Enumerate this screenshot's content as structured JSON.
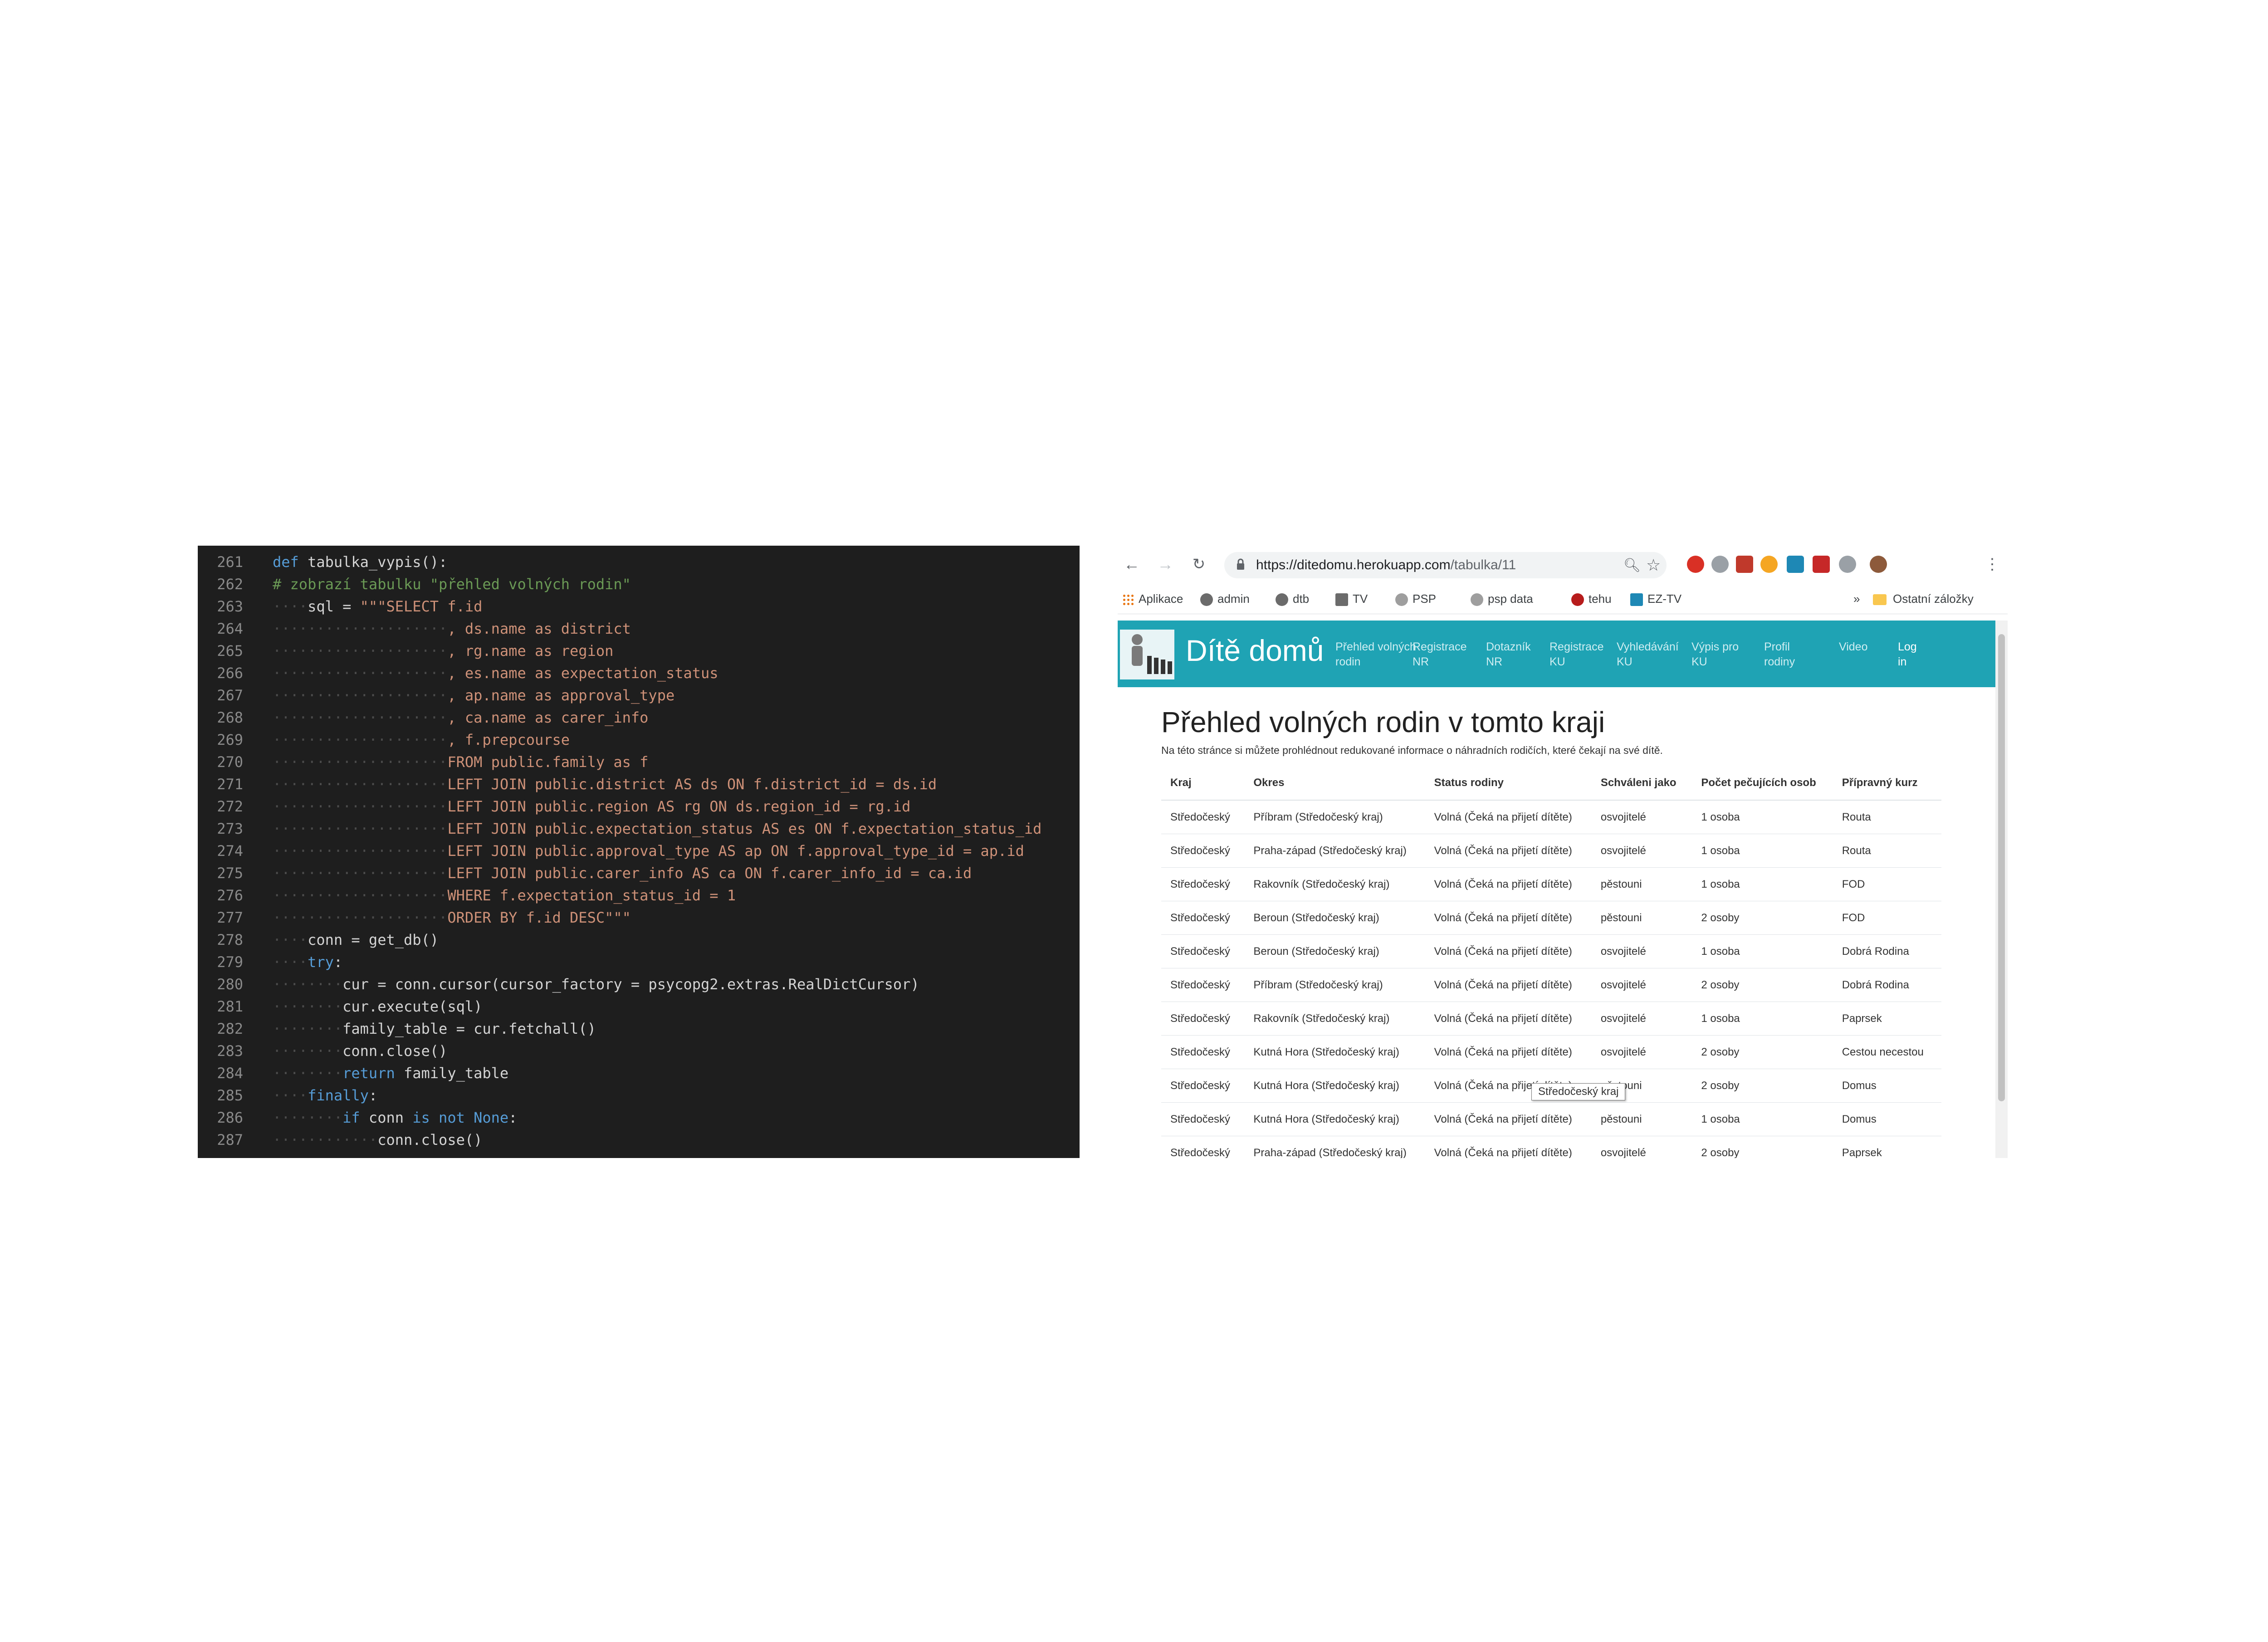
{
  "editor": {
    "lines": [
      {
        "n": "261",
        "parts": [
          {
            "t": "def",
            "c": "kw"
          },
          {
            "t": " tabulka_vypis():",
            "c": ""
          }
        ]
      },
      {
        "n": "262",
        "parts": [
          {
            "t": "# zobrazí tabulku \"přehled volných rodin\"",
            "c": "cm"
          }
        ]
      },
      {
        "n": "263",
        "parts": [
          {
            "t": "····",
            "c": "ws"
          },
          {
            "t": "sql = ",
            "c": ""
          },
          {
            "t": "\"\"\"SELECT f.id",
            "c": "str"
          }
        ]
      },
      {
        "n": "264",
        "parts": [
          {
            "t": "····················",
            "c": "ws"
          },
          {
            "t": ", ds.name as district",
            "c": "str"
          }
        ]
      },
      {
        "n": "265",
        "parts": [
          {
            "t": "····················",
            "c": "ws"
          },
          {
            "t": ", rg.name as region",
            "c": "str"
          }
        ]
      },
      {
        "n": "266",
        "parts": [
          {
            "t": "····················",
            "c": "ws"
          },
          {
            "t": ", es.name as expectation_status",
            "c": "str"
          }
        ]
      },
      {
        "n": "267",
        "parts": [
          {
            "t": "····················",
            "c": "ws"
          },
          {
            "t": ", ap.name as approval_type",
            "c": "str"
          }
        ]
      },
      {
        "n": "268",
        "parts": [
          {
            "t": "····················",
            "c": "ws"
          },
          {
            "t": ", ca.name as carer_info",
            "c": "str"
          }
        ]
      },
      {
        "n": "269",
        "parts": [
          {
            "t": "····················",
            "c": "ws"
          },
          {
            "t": ", f.prepcourse",
            "c": "str"
          }
        ]
      },
      {
        "n": "270",
        "parts": [
          {
            "t": "····················",
            "c": "ws"
          },
          {
            "t": "FROM public.family as f",
            "c": "str"
          }
        ]
      },
      {
        "n": "271",
        "parts": [
          {
            "t": "····················",
            "c": "ws"
          },
          {
            "t": "LEFT JOIN public.district AS ds ON f.district_id = ds.id",
            "c": "str"
          }
        ]
      },
      {
        "n": "272",
        "parts": [
          {
            "t": "····················",
            "c": "ws"
          },
          {
            "t": "LEFT JOIN public.region AS rg ON ds.region_id = rg.id",
            "c": "str"
          }
        ]
      },
      {
        "n": "273",
        "parts": [
          {
            "t": "····················",
            "c": "ws"
          },
          {
            "t": "LEFT JOIN public.expectation_status AS es ON f.expectation_status_id",
            "c": "str"
          }
        ]
      },
      {
        "n": "274",
        "parts": [
          {
            "t": "····················",
            "c": "ws"
          },
          {
            "t": "LEFT JOIN public.approval_type AS ap ON f.approval_type_id = ap.id",
            "c": "str"
          }
        ]
      },
      {
        "n": "275",
        "parts": [
          {
            "t": "····················",
            "c": "ws"
          },
          {
            "t": "LEFT JOIN public.carer_info AS ca ON f.carer_info_id = ca.id",
            "c": "str"
          }
        ]
      },
      {
        "n": "276",
        "parts": [
          {
            "t": "····················",
            "c": "ws"
          },
          {
            "t": "WHERE f.expectation_status_id = 1",
            "c": "str"
          }
        ]
      },
      {
        "n": "277",
        "parts": [
          {
            "t": "····················",
            "c": "ws"
          },
          {
            "t": "ORDER BY f.id DESC\"\"\"",
            "c": "str"
          }
        ]
      },
      {
        "n": "278",
        "parts": [
          {
            "t": "····",
            "c": "ws"
          },
          {
            "t": "conn = get_db()",
            "c": ""
          }
        ]
      },
      {
        "n": "279",
        "parts": [
          {
            "t": "····",
            "c": "ws"
          },
          {
            "t": "try",
            "c": "kw"
          },
          {
            "t": ":",
            "c": ""
          }
        ]
      },
      {
        "n": "280",
        "parts": [
          {
            "t": "········",
            "c": "ws"
          },
          {
            "t": "cur = conn.cursor(cursor_factory = psycopg2.extras.RealDictCursor)",
            "c": ""
          }
        ]
      },
      {
        "n": "281",
        "parts": [
          {
            "t": "········",
            "c": "ws"
          },
          {
            "t": "cur.execute(sql)",
            "c": ""
          }
        ]
      },
      {
        "n": "282",
        "parts": [
          {
            "t": "········",
            "c": "ws"
          },
          {
            "t": "family_table = cur.fetchall()",
            "c": ""
          }
        ]
      },
      {
        "n": "283",
        "parts": [
          {
            "t": "········",
            "c": "ws"
          },
          {
            "t": "conn.close()",
            "c": ""
          }
        ]
      },
      {
        "n": "284",
        "parts": [
          {
            "t": "········",
            "c": "ws"
          },
          {
            "t": "return",
            "c": "kw"
          },
          {
            "t": " family_table",
            "c": ""
          }
        ]
      },
      {
        "n": "285",
        "parts": [
          {
            "t": "····",
            "c": "ws"
          },
          {
            "t": "finally",
            "c": "kw"
          },
          {
            "t": ":",
            "c": ""
          }
        ]
      },
      {
        "n": "286",
        "parts": [
          {
            "t": "········",
            "c": "ws"
          },
          {
            "t": "if",
            "c": "kw"
          },
          {
            "t": " conn ",
            "c": ""
          },
          {
            "t": "is not None",
            "c": "kw"
          },
          {
            "t": ":",
            "c": ""
          }
        ]
      },
      {
        "n": "287",
        "parts": [
          {
            "t": "············",
            "c": "ws"
          },
          {
            "t": "conn.close()",
            "c": ""
          }
        ]
      }
    ]
  },
  "browser": {
    "url_host": "https://ditedomu.herokuapp.com",
    "url_path": "/tabulka/11",
    "bookmarks": [
      "Aplikace",
      "admin",
      "dtb",
      "TV",
      "PSP",
      "psp data",
      "tehu",
      "EZ-TV"
    ],
    "more_bookmarks": "»",
    "other_bookmarks": "Ostatní záložky",
    "extension_colors": [
      "#d93025",
      "#9aa0a6",
      "#c0392b",
      "#f5a623",
      "#1e88b5",
      "#c62828",
      "#9aa0a6",
      "#8d5a3b"
    ]
  },
  "site": {
    "title": "Dítě domů",
    "nav": [
      {
        "line1": "Přehled volných",
        "line2": "rodin"
      },
      {
        "line1": "Registrace",
        "line2": "NR"
      },
      {
        "line1": "Dotazník",
        "line2": "NR"
      },
      {
        "line1": "Registrace",
        "line2": "KU"
      },
      {
        "line1": "Vyhledávání",
        "line2": "KU"
      },
      {
        "line1": "Výpis pro",
        "line2": "KU"
      },
      {
        "line1": "Profil",
        "line2": "rodiny"
      },
      {
        "line1": "Video",
        "line2": ""
      },
      {
        "line1": "Log",
        "line2": "in"
      }
    ],
    "heading": "Přehled volných rodin v tomto kraji",
    "description": "Na této stránce si můžete prohlédnout redukované informace o náhradních rodičích, které čekají na své dítě.",
    "table": {
      "headers": [
        "Kraj",
        "Okres",
        "Status rodiny",
        "Schváleni jako",
        "Počet pečujících osob",
        "Přípravný kurz"
      ],
      "rows": [
        [
          "Středočeský",
          "Příbram (Středočeský kraj)",
          "Volná (Čeká na přijetí dítěte)",
          "osvojitelé",
          "1 osoba",
          "Routa"
        ],
        [
          "Středočeský",
          "Praha-západ (Středočeský kraj)",
          "Volná (Čeká na přijetí dítěte)",
          "osvojitelé",
          "1 osoba",
          "Routa"
        ],
        [
          "Středočeský",
          "Rakovník (Středočeský kraj)",
          "Volná (Čeká na přijetí dítěte)",
          "pěstouni",
          "1 osoba",
          "FOD"
        ],
        [
          "Středočeský",
          "Beroun (Středočeský kraj)",
          "Volná (Čeká na přijetí dítěte)",
          "pěstouni",
          "2 osoby",
          "FOD"
        ],
        [
          "Středočeský",
          "Beroun (Středočeský kraj)",
          "Volná (Čeká na přijetí dítěte)",
          "osvojitelé",
          "1 osoba",
          "Dobrá Rodina"
        ],
        [
          "Středočeský",
          "Příbram (Středočeský kraj)",
          "Volná (Čeká na přijetí dítěte)",
          "osvojitelé",
          "2 osoby",
          "Dobrá Rodina"
        ],
        [
          "Středočeský",
          "Rakovník (Středočeský kraj)",
          "Volná (Čeká na přijetí dítěte)",
          "osvojitelé",
          "1 osoba",
          "Paprsek"
        ],
        [
          "Středočeský",
          "Kutná Hora (Středočeský kraj)",
          "Volná (Čeká na přijetí dítěte)",
          "osvojitelé",
          "2 osoby",
          "Cestou necestou"
        ],
        [
          "Středočeský",
          "Kutná Hora (Středočeský kraj)",
          "Volná (Čeká na přijetí dítěte)",
          "pěstouni",
          "2 osoby",
          "Domus"
        ],
        [
          "Středočeský",
          "Kutná Hora (Středočeský kraj)",
          "Volná (Čeká na přijetí dítěte)",
          "pěstouni",
          "1 osoba",
          "Domus"
        ],
        [
          "Středočeský",
          "Praha-západ (Středočeský kraj)",
          "Volná (Čeká na přijetí dítěte)",
          "osvojitelé",
          "2 osoby",
          "Paprsek"
        ]
      ]
    },
    "tooltip": "Středočeský kraj"
  }
}
